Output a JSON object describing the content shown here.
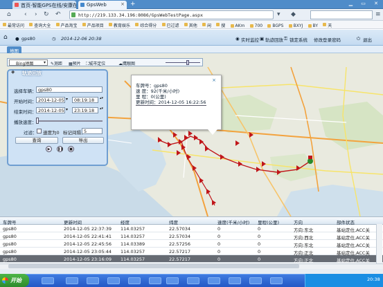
{
  "browser": {
    "tabs": [
      {
        "label": "首页-智能GPS在线/安康在"
      },
      {
        "label": "GpsWeb"
      }
    ],
    "new_tab": "+",
    "address": "http://219.133.34.196:8086/GpsWebTestPage.aspx",
    "bookmarks": [
      "最常访问",
      "查询大全",
      "产品淘宝",
      "产品项目",
      "教育娱乐",
      "综合得分",
      "已过滤",
      "其他",
      "闲",
      "搜",
      "AKm",
      "700",
      "BGPS",
      "BXYJ",
      "BY",
      "天"
    ]
  },
  "app_header": {
    "user": "gps80",
    "date": "2014-12-06 20:38",
    "links": [
      "实时监控",
      "轨迹回放",
      "锁定系统",
      "修改登录密码",
      "退出"
    ]
  },
  "map_tab": "地图",
  "map_toolbar": {
    "map_type": "Bing地图",
    "tools": [
      "测距",
      "预片",
      "城市定位",
      "鹰眼图"
    ]
  },
  "query_panel": {
    "title": "轨迹回放",
    "vehicle_label": "选择车辆：",
    "vehicle_value": "gps80",
    "start_label": "开始时间：",
    "start_date": "2014-12-05",
    "start_time": "08:19:18",
    "end_label": "结束时间：",
    "end_date": "2014-12-05",
    "end_time": "23:19:18",
    "speed_label": "播放速度：",
    "filter_label": "过滤：",
    "speed_zero_label": "速度为0",
    "mark_label": "标记间隔：",
    "mark_value": "5",
    "query_button": "查询",
    "export_button": "导出"
  },
  "popup": {
    "plate_label": "车牌号：",
    "plate_value": "gps80",
    "speed_label": "速    度：",
    "speed_value": "92(千米/小时)",
    "mileage_label": "里    程：",
    "mileage_value": "0(公里)",
    "time_label": "更新时间：",
    "time_value": "2014-12-05 16:22:56",
    "close": "×"
  },
  "table": {
    "headers": [
      "车牌号",
      "更新时间",
      "经度",
      "纬度",
      "速度(千米/小时)",
      "里程(公里)",
      "方向",
      "部件状态"
    ],
    "rows": [
      [
        "gps80",
        "2014-12-05 22:37:39",
        "114.03257",
        "22.57034",
        "0",
        "0",
        "方向:东北",
        "基站定位,ACC关"
      ],
      [
        "gps80",
        "2014-12-05 22:41:41",
        "114.03257",
        "22.57034",
        "0",
        "0",
        "方向:西北",
        "基站定位,ACC关"
      ],
      [
        "gps80",
        "2014-12-05 22:45:56",
        "114.03389",
        "22.57256",
        "0",
        "0",
        "方向:东北",
        "基站定位,ACC关"
      ],
      [
        "gps80",
        "2014-12-05 23:05:44",
        "114.03257",
        "22.57217",
        "0",
        "0",
        "方向:正北",
        "基站定位,ACC关"
      ],
      [
        "gps80",
        "2014-12-05 23:16:09",
        "114.03257",
        "22.57217",
        "0",
        "0",
        "方向:正北",
        "基站定位,ACC关"
      ]
    ],
    "selected_row": 4
  },
  "taskbar": {
    "start": "开始",
    "clock": "20:38"
  },
  "colors": {
    "accent": "#4f8cc9",
    "track": "#c0161a",
    "road_orange": "#f3a23d",
    "road_yellow": "#f7e46a",
    "water": "#c9dbe8"
  }
}
